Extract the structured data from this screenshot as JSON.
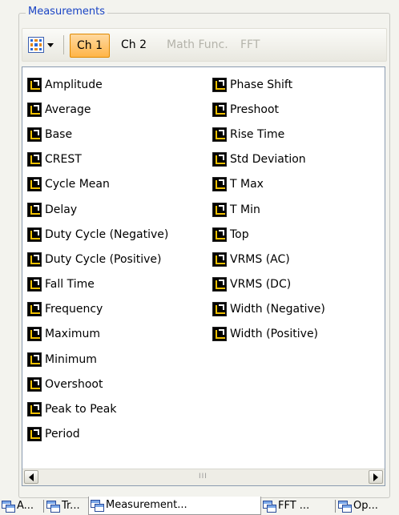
{
  "panel": {
    "title": "Measurements"
  },
  "toolbar": {
    "tabs": [
      {
        "label": "Ch 1",
        "state": "active"
      },
      {
        "label": "Ch 2",
        "state": "normal"
      },
      {
        "label": "Math Func.",
        "state": "disabled"
      },
      {
        "label": "FFT",
        "state": "disabled"
      }
    ]
  },
  "measurements": {
    "left": [
      {
        "label": "Amplitude",
        "icon": "amplitude-icon"
      },
      {
        "label": "Average",
        "icon": "average-icon"
      },
      {
        "label": "Base",
        "icon": "base-icon"
      },
      {
        "label": "CREST",
        "icon": "crest-icon"
      },
      {
        "label": "Cycle Mean",
        "icon": "cycle-mean-icon"
      },
      {
        "label": "Delay",
        "icon": "delay-icon"
      },
      {
        "label": "Duty Cycle (Negative)",
        "icon": "duty-cycle-negative-icon"
      },
      {
        "label": "Duty Cycle (Positive)",
        "icon": "duty-cycle-positive-icon"
      },
      {
        "label": "Fall Time",
        "icon": "fall-time-icon"
      },
      {
        "label": "Frequency",
        "icon": "frequency-icon"
      },
      {
        "label": "Maximum",
        "icon": "maximum-icon"
      },
      {
        "label": "Minimum",
        "icon": "minimum-icon"
      },
      {
        "label": "Overshoot",
        "icon": "overshoot-icon"
      },
      {
        "label": "Peak to Peak",
        "icon": "peak-to-peak-icon"
      },
      {
        "label": "Period",
        "icon": "period-icon"
      }
    ],
    "right": [
      {
        "label": "Phase Shift",
        "icon": "phase-shift-icon"
      },
      {
        "label": "Preshoot",
        "icon": "preshoot-icon"
      },
      {
        "label": "Rise Time",
        "icon": "rise-time-icon"
      },
      {
        "label": "Std Deviation",
        "icon": "std-deviation-icon"
      },
      {
        "label": "T Max",
        "icon": "t-max-icon"
      },
      {
        "label": "T Min",
        "icon": "t-min-icon"
      },
      {
        "label": "Top",
        "icon": "top-icon"
      },
      {
        "label": "VRMS (AC)",
        "icon": "vrms-ac-icon"
      },
      {
        "label": "VRMS (DC)",
        "icon": "vrms-dc-icon"
      },
      {
        "label": "Width (Negative)",
        "icon": "width-negative-icon"
      },
      {
        "label": "Width (Positive)",
        "icon": "width-positive-icon"
      }
    ]
  },
  "scrollbar": {
    "grip": "III"
  },
  "bottom_tabs": [
    {
      "label": "A...",
      "state": "normal"
    },
    {
      "label": "Tr...",
      "state": "normal"
    },
    {
      "label": "Measurement...",
      "state": "active"
    },
    {
      "label": "FFT ...",
      "state": "normal"
    },
    {
      "label": "Op...",
      "state": "normal"
    }
  ]
}
